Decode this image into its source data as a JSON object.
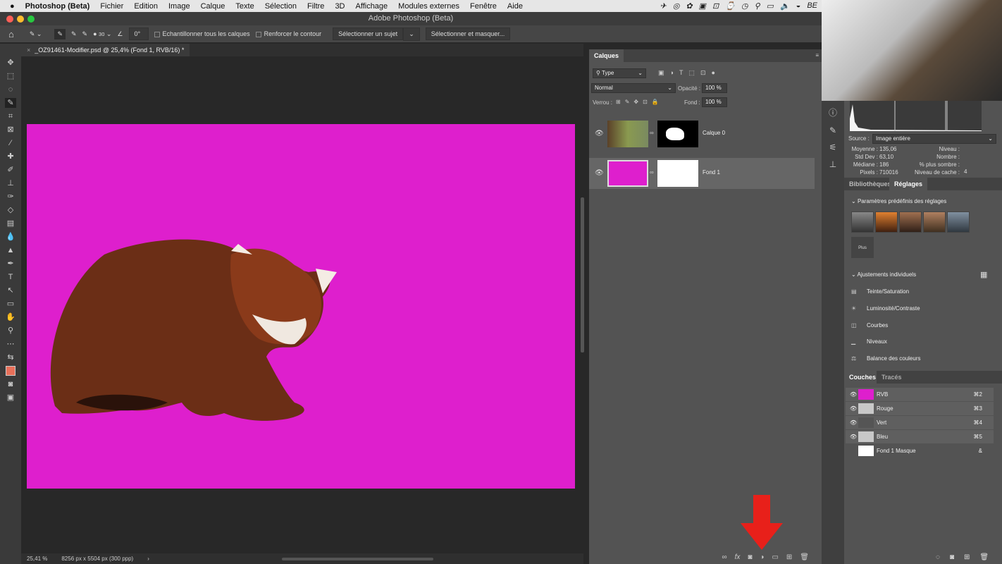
{
  "menubar": {
    "apple": "",
    "app": "Photoshop (Beta)",
    "items": [
      "Fichier",
      "Edition",
      "Image",
      "Calque",
      "Texte",
      "Sélection",
      "Filtre",
      "3D",
      "Affichage",
      "Modules externes",
      "Fenêtre",
      "Aide"
    ],
    "sys": [
      "✈",
      "◎",
      "✿",
      "▣",
      "⊡",
      "⌚",
      "◷",
      "⚲",
      "▭",
      "🔈",
      "◒",
      "BE"
    ]
  },
  "window": {
    "title": "Adobe Photoshop (Beta)"
  },
  "options": {
    "brush_size": "30",
    "angle": "0°",
    "sample_all": "Echantillonner tous les calques",
    "enhance": "Renforcer le contour",
    "select_subject": "Sélectionner un sujet",
    "select_mask": "Sélectionner et masquer..."
  },
  "document": {
    "tab": "_OZ91461-Modifier.psd @ 25,4% (Fond 1, RVB/16) *",
    "canvas_color": "#de1fcd"
  },
  "status": {
    "zoom": "25,41 %",
    "size": "8256 px x 5504 px (300 ppp)",
    "arrow": "›"
  },
  "layers_panel": {
    "tab": "Calques",
    "filter": "Type",
    "blend": "Normal",
    "opacity_label": "Opacité :",
    "opacity": "100 %",
    "lock_label": "Verrou :",
    "fill_label": "Fond :",
    "fill": "100 %",
    "layers": [
      {
        "name": "Calque 0",
        "visible": true
      },
      {
        "name": "Fond 1",
        "visible": true,
        "selected": true
      }
    ]
  },
  "histogram": {
    "source_label": "Source :",
    "source": "Image entière",
    "stats": [
      {
        "k": "Moyenne :",
        "v": "135,06"
      },
      {
        "k": "Std Dev :",
        "v": "63,10"
      },
      {
        "k": "Médiane :",
        "v": "186"
      },
      {
        "k": "Pixels :",
        "v": "710016"
      }
    ],
    "stats2": [
      {
        "k": "Niveau :",
        "v": ""
      },
      {
        "k": "Nombre :",
        "v": ""
      },
      {
        "k": "% plus sombre :",
        "v": ""
      },
      {
        "k": "Niveau de cache :",
        "v": "4"
      }
    ]
  },
  "adjustments": {
    "tabs": [
      "Bibliothèques",
      "Réglages"
    ],
    "presets_title": "Paramètres prédéfinis des réglages",
    "more": "Plus",
    "individual_title": "Ajustements individuels",
    "items": [
      {
        "icon": "▤",
        "label": "Teinte/Saturation"
      },
      {
        "icon": "☀",
        "label": "Luminosité/Contraste"
      },
      {
        "icon": "◫",
        "label": "Courbes"
      },
      {
        "icon": "▁",
        "label": "Niveaux"
      },
      {
        "icon": "⚖",
        "label": "Balance des couleurs"
      }
    ]
  },
  "channels": {
    "tabs": [
      "Couches",
      "Tracés"
    ],
    "items": [
      {
        "name": "RVB",
        "key": "⌘2",
        "color": "#de1fcd"
      },
      {
        "name": "Rouge",
        "key": "⌘3",
        "color": "#c8c8c8"
      },
      {
        "name": "Vert",
        "key": "⌘4",
        "color": "#555555"
      },
      {
        "name": "Bleu",
        "key": "⌘5",
        "color": "#c8c8c8"
      },
      {
        "name": "Fond 1 Masque",
        "key": "&",
        "color": "#ffffff"
      }
    ]
  },
  "accent": {
    "arrow": "#e8201a"
  }
}
